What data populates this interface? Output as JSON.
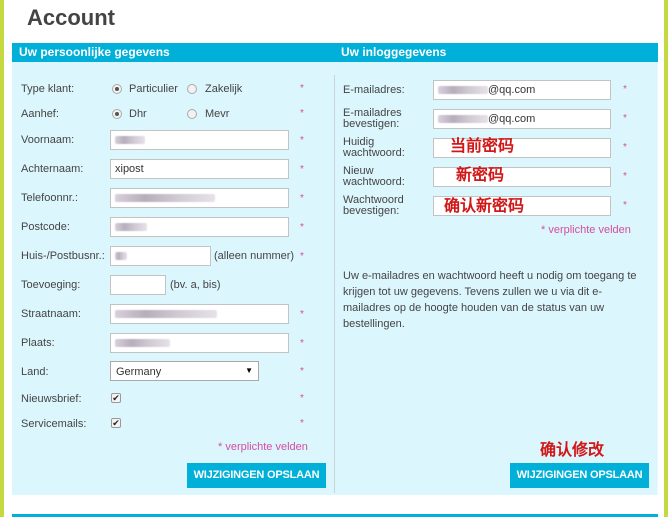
{
  "page": {
    "title": "Account"
  },
  "colors": {
    "accent": "#00b0d9",
    "panel_bg": "#dcf6fd",
    "required": "#d44e9d",
    "annotation": "#d01818",
    "side_bar": "#c3d93f"
  },
  "personal": {
    "header": "Uw persoonlijke gegevens",
    "type_klant": {
      "label": "Type klant:",
      "options": [
        "Particulier",
        "Zakelijk"
      ],
      "selected": "Particulier"
    },
    "aanhef": {
      "label": "Aanhef:",
      "options": [
        "Dhr",
        "Mevr"
      ],
      "selected": "Dhr"
    },
    "voornaam": {
      "label": "Voornaam:",
      "value": ""
    },
    "achternaam": {
      "label": "Achternaam:",
      "value": "xipost"
    },
    "telefoon": {
      "label": "Telefoonnr.:",
      "value": ""
    },
    "postcode": {
      "label": "Postcode:",
      "value": ""
    },
    "huisnummer": {
      "label": "Huis-/Postbusnr.:",
      "value": "",
      "hint": "(alleen nummer)"
    },
    "toevoeging": {
      "label": "Toevoeging:",
      "value": "",
      "hint": "(bv. a, bis)"
    },
    "straatnaam": {
      "label": "Straatnaam:",
      "value": ""
    },
    "plaats": {
      "label": "Plaats:",
      "value": ""
    },
    "land": {
      "label": "Land:",
      "selected": "Germany"
    },
    "nieuwsbrief": {
      "label": "Nieuwsbrief:",
      "checked": true,
      "mark": "✔"
    },
    "servicemails": {
      "label": "Servicemails:",
      "checked": true,
      "mark": "✔"
    },
    "required_star": "*",
    "required_note": "* verplichte velden",
    "save_label": "WIJZIGINGEN OPSLAAN"
  },
  "login": {
    "header": "Uw inloggegevens",
    "email": {
      "label": "E-mailadres:",
      "value_suffix": "@qq.com"
    },
    "email_confirm": {
      "label1": "E-mailadres",
      "label2": "bevestigen:",
      "value_suffix": "@qq.com"
    },
    "current_password": {
      "label1": "Huidig",
      "label2": "wachtwoord:",
      "annotation": "当前密码"
    },
    "new_password": {
      "label1": "Nieuw",
      "label2": "wachtwoord:",
      "annotation": "新密码"
    },
    "confirm_password": {
      "label1": "Wachtwoord",
      "label2": "bevestigen:",
      "annotation": "确认新密码"
    },
    "required_star": "*",
    "required_note": "* verplichte velden",
    "info_text": "Uw e-mailadres en wachtwoord heeft u nodig om toegang te krijgen tot uw gegevens. Tevens zullen we u via dit e-mailadres op de hoogte houden van de status van uw bestellingen.",
    "confirm_annotation": "确认修改",
    "save_label": "WIJZIGINGEN OPSLAAN"
  }
}
